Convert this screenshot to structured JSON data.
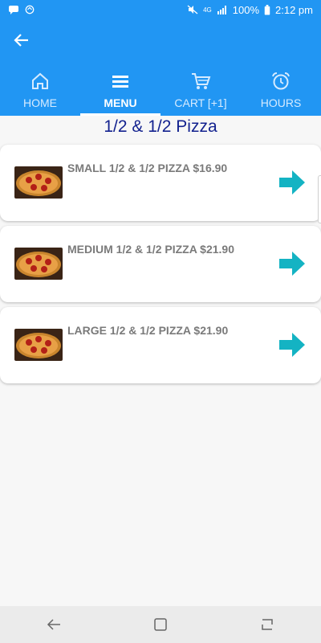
{
  "status_bar": {
    "battery": "100%",
    "time": "2:12 pm",
    "network": "4G"
  },
  "tabs": [
    {
      "label": "HOME",
      "icon": "home-icon",
      "active": false
    },
    {
      "label": "MENU",
      "icon": "menu-icon",
      "active": true
    },
    {
      "label": "CART [+1]",
      "icon": "cart-icon",
      "active": false
    },
    {
      "label": "HOURS",
      "icon": "alarm-clock-icon",
      "active": false
    }
  ],
  "page": {
    "title": "1/2 & 1/2 Pizza"
  },
  "items": [
    {
      "label": "SMALL 1/2 & 1/2 PIZZA $16.90",
      "icon": "pizza-thumbnail"
    },
    {
      "label": "MEDIUM 1/2 & 1/2 PIZZA $21.90",
      "icon": "pizza-thumbnail"
    },
    {
      "label": "LARGE 1/2 & 1/2 PIZZA $21.90",
      "icon": "pizza-thumbnail"
    }
  ],
  "colors": {
    "primary": "#2196f3",
    "title": "#13228f",
    "arrow": "#14b3c3"
  }
}
